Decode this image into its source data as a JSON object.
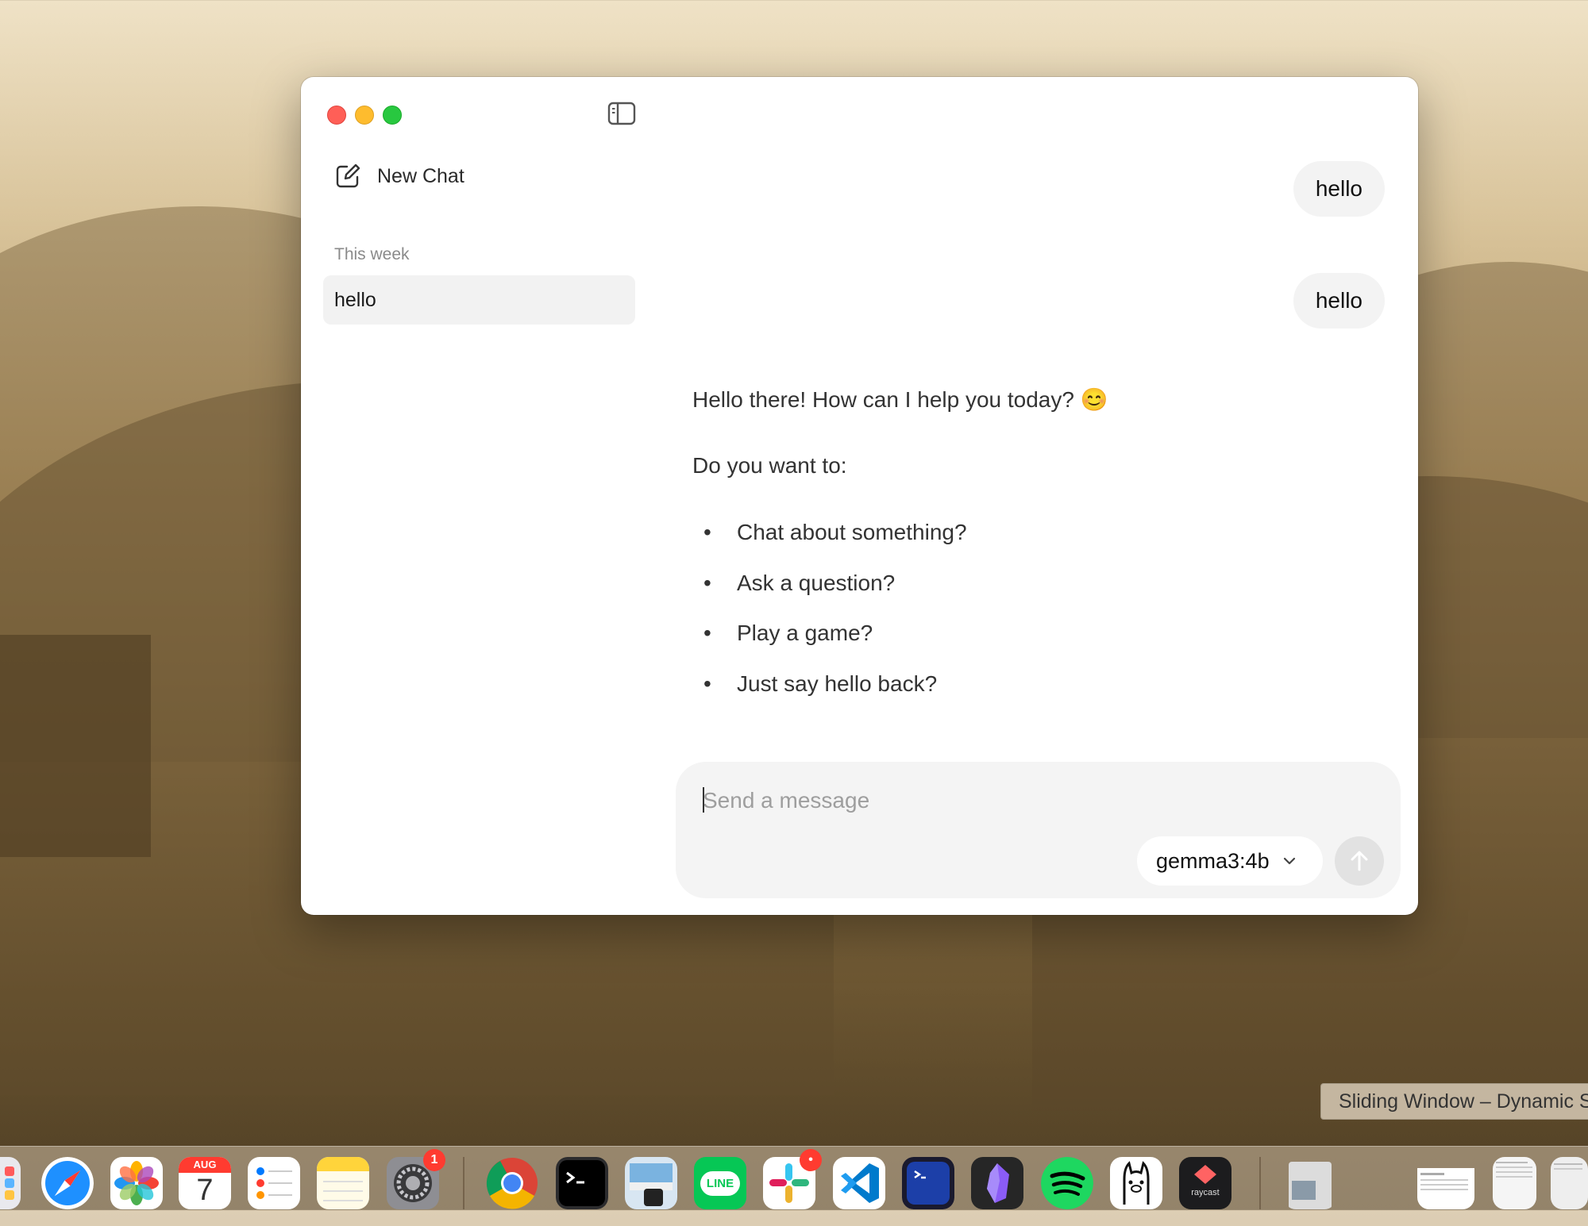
{
  "window": {
    "sidebar": {
      "new_chat_label": "New Chat",
      "section_label": "This week",
      "chats": [
        {
          "label": "hello"
        }
      ]
    },
    "conversation": {
      "user_messages": [
        "hello",
        "hello"
      ],
      "assistant_reply": {
        "greeting": "Hello there! How can I help you today? 😊",
        "prompt": "Do you want to:",
        "options": [
          "Chat about something?",
          "Ask a question?",
          "Play a game?",
          "Just say hello back?"
        ]
      }
    },
    "composer": {
      "placeholder": "Send a message",
      "value": "",
      "model": "gemma3:4b"
    }
  },
  "tooltip": {
    "text": "Sliding Window – Dynamic S"
  },
  "dock": {
    "calendar": {
      "month": "AUG",
      "day": "7"
    },
    "settings_badge": "1",
    "slack_badge": "•",
    "line_label": "LINE",
    "raycast_label": "raycast",
    "icons": [
      "launchpad-icon",
      "safari-icon",
      "photos-icon",
      "calendar-icon",
      "reminders-icon",
      "notes-icon",
      "system-settings-icon",
      "chrome-icon",
      "terminal-icon",
      "preview-icon",
      "line-icon",
      "slack-icon",
      "vscode-icon",
      "ssh-client-icon",
      "obsidian-icon",
      "spotify-icon",
      "ollama-icon",
      "raycast-icon",
      "downloads-stack-icon"
    ]
  }
}
